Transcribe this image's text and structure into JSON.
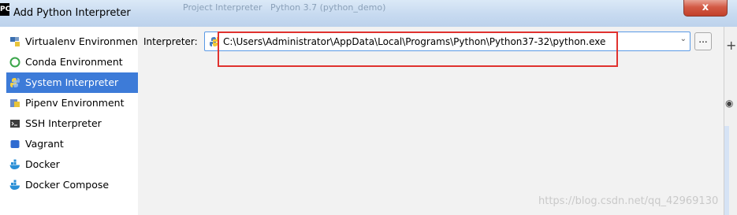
{
  "window": {
    "app_icon_text": "PC",
    "title": "Add Python Interpreter",
    "close_symbol": "x",
    "background_texts": [
      "Project Interpreter",
      "Python 3.7 (python_demo)"
    ]
  },
  "sidebar": {
    "items": [
      {
        "label": "Virtualenv Environment",
        "icon": "virtualenv-icon",
        "selected": false
      },
      {
        "label": "Conda Environment",
        "icon": "conda-icon",
        "selected": false
      },
      {
        "label": "System Interpreter",
        "icon": "python-icon",
        "selected": true
      },
      {
        "label": "Pipenv Environment",
        "icon": "pipenv-icon",
        "selected": false
      },
      {
        "label": "SSH Interpreter",
        "icon": "terminal-icon",
        "selected": false
      },
      {
        "label": "Vagrant",
        "icon": "vagrant-icon",
        "selected": false
      },
      {
        "label": "Docker",
        "icon": "docker-icon",
        "selected": false
      },
      {
        "label": "Docker Compose",
        "icon": "docker-icon",
        "selected": false
      }
    ]
  },
  "main": {
    "interpreter_label": "Interpreter:",
    "interpreter_value": "C:\\Users\\Administrator\\AppData\\Local\\Programs\\Python\\Python37-32\\python.exe",
    "browse_label": "...",
    "dropdown_arrow": "⌄"
  },
  "watermark": "https://blog.csdn.net/qq_42969130",
  "colors": {
    "selection": "#3d7bd8",
    "highlight_box": "#e0322f",
    "combo_border": "#5a9ae6"
  }
}
